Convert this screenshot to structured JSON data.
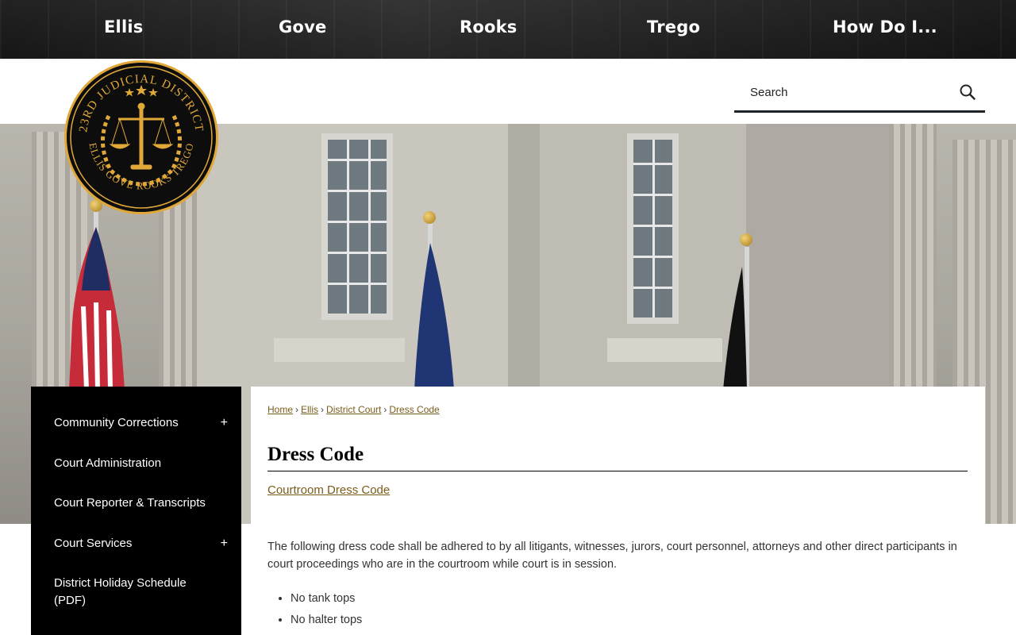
{
  "topnav": {
    "items": [
      "Ellis",
      "Gove",
      "Rooks",
      "Trego",
      "How Do I..."
    ]
  },
  "logo": {
    "arc_top": "23RD JUDICIAL DISTRICT",
    "arc_bottom": "ELLIS GOVE ROOKS TREGO"
  },
  "search": {
    "placeholder": "Search"
  },
  "sidebar": {
    "items": [
      {
        "label": "Community Corrections",
        "expand": "+"
      },
      {
        "label": "Court Administration",
        "expand": ""
      },
      {
        "label": "Court Reporter & Transcripts",
        "expand": ""
      },
      {
        "label": "Court Services",
        "expand": "+"
      },
      {
        "label": "District Holiday Schedule (PDF)",
        "expand": ""
      }
    ]
  },
  "breadcrumb": {
    "items": [
      "Home",
      "Ellis",
      "District Court",
      "Dress Code"
    ],
    "separator": "›"
  },
  "page": {
    "title": "Dress Code",
    "link": "Courtroom Dress Code",
    "paragraph": "The following dress code shall be adhered to by all litigants, witnesses, jurors, court personnel, attorneys and other direct participants in court proceedings who are in the courtroom while court is in session.",
    "bullets": [
      "No tank tops",
      "No halter tops"
    ]
  },
  "colors": {
    "link": "#7a5c1a",
    "sidebar_bg": "#000000",
    "logo_gold": "#e0a838"
  }
}
